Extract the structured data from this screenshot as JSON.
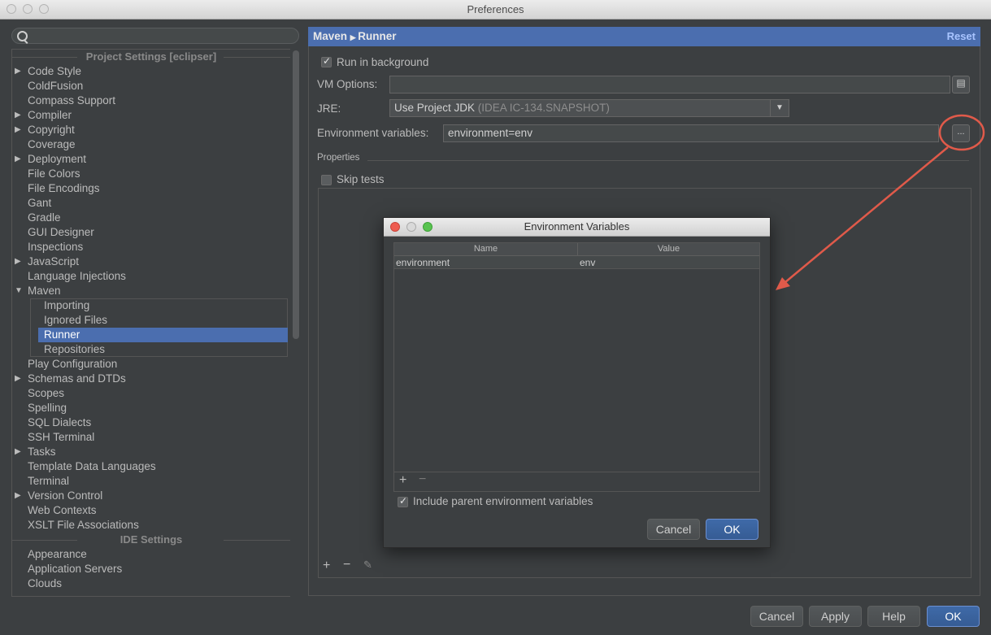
{
  "window": {
    "title": "Preferences"
  },
  "sidebar": {
    "project_group": "Project Settings [eclipser]",
    "ide_group": "IDE Settings",
    "items": [
      {
        "label": "Code Style",
        "arrow": true
      },
      {
        "label": "ColdFusion",
        "arrow": false
      },
      {
        "label": "Compass Support",
        "arrow": false
      },
      {
        "label": "Compiler",
        "arrow": true
      },
      {
        "label": "Copyright",
        "arrow": true
      },
      {
        "label": "Coverage",
        "arrow": false
      },
      {
        "label": "Deployment",
        "arrow": true
      },
      {
        "label": "File Colors",
        "arrow": false
      },
      {
        "label": "File Encodings",
        "arrow": false
      },
      {
        "label": "Gant",
        "arrow": false
      },
      {
        "label": "Gradle",
        "arrow": false
      },
      {
        "label": "GUI Designer",
        "arrow": false
      },
      {
        "label": "Inspections",
        "arrow": false
      },
      {
        "label": "JavaScript",
        "arrow": true
      },
      {
        "label": "Language Injections",
        "arrow": false
      },
      {
        "label": "Maven",
        "arrow": true
      }
    ],
    "maven_children": [
      "Importing",
      "Ignored Files",
      "Runner",
      "Repositories"
    ],
    "items_after": [
      {
        "label": "Play Configuration",
        "arrow": false
      },
      {
        "label": "Schemas and DTDs",
        "arrow": true
      },
      {
        "label": "Scopes",
        "arrow": false
      },
      {
        "label": "Spelling",
        "arrow": false
      },
      {
        "label": "SQL Dialects",
        "arrow": false
      },
      {
        "label": "SSH Terminal",
        "arrow": false
      },
      {
        "label": "Tasks",
        "arrow": true
      },
      {
        "label": "Template Data Languages",
        "arrow": false
      },
      {
        "label": "Terminal",
        "arrow": false
      },
      {
        "label": "Version Control",
        "arrow": true
      },
      {
        "label": "Web Contexts",
        "arrow": false
      },
      {
        "label": "XSLT File Associations",
        "arrow": false
      }
    ],
    "ide_items": [
      "Appearance",
      "Application Servers",
      "Clouds"
    ]
  },
  "header": {
    "crumb_parent": "Maven",
    "crumb_current": "Runner",
    "reset": "Reset"
  },
  "form": {
    "run_in_background": "Run in background",
    "vm_options_label": "VM Options:",
    "vm_options_value": "",
    "jre_label": "JRE:",
    "jre_value": "Use Project JDK",
    "jre_hint": "(IDEA IC-134.SNAPSHOT)",
    "env_label": "Environment variables:",
    "env_value": "environment=env",
    "env_button": "...",
    "properties_label": "Properties",
    "skip_tests": "Skip tests"
  },
  "dialog": {
    "title": "Environment Variables",
    "col_name": "Name",
    "col_value": "Value",
    "row_name": "environment",
    "row_value": "env",
    "include_parent": "Include parent environment variables",
    "cancel": "Cancel",
    "ok": "OK"
  },
  "footer": {
    "cancel": "Cancel",
    "apply": "Apply",
    "help": "Help",
    "ok": "OK"
  },
  "colors": {
    "accent": "#4b6eaf",
    "annotation": "#e05a4a"
  },
  "icons": [
    "search-icon",
    "expand-arrow-icon",
    "expand-vm-icon",
    "dropdown-arrow-icon",
    "add-icon",
    "remove-icon",
    "edit-icon"
  ]
}
